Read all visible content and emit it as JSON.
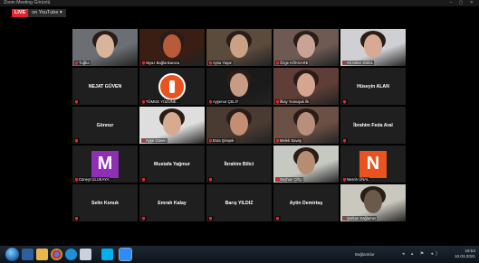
{
  "window": {
    "title": "Zoom Meeting Görüntü",
    "controls": "– ▢ ✕"
  },
  "live": {
    "badge": "LIVE",
    "destination": "on YouTube ▾"
  },
  "tiles": [
    {
      "kind": "video",
      "label": "Tuğba",
      "colors": [
        "#6b6f74",
        "#d8b49a"
      ]
    },
    {
      "kind": "video",
      "label": "Niyaz Bağlankaraca",
      "colors": [
        "#3a1e14",
        "#b85b3a"
      ]
    },
    {
      "kind": "video",
      "label": "Aysa Yaşar",
      "colors": [
        "#5a4b3d",
        "#caa184"
      ]
    },
    {
      "kind": "video",
      "label": "Özge KÖKSARE",
      "colors": [
        "#6e5a52",
        "#c9a394"
      ]
    },
    {
      "kind": "video",
      "label": "Ali Asker DİZEL",
      "colors": [
        "#cfcfd4",
        "#d8aa96"
      ]
    },
    {
      "kind": "name",
      "name": "NEJAT GÜVEN"
    },
    {
      "kind": "logo",
      "label": "TÜMGE YÜZÜNE..."
    },
    {
      "kind": "video",
      "label": "Ayşenur ÇELİT",
      "colors": [
        "#1a1a1a",
        "#c79b84"
      ]
    },
    {
      "kind": "video",
      "label": "İlkay Yumuşak İlk",
      "colors": [
        "#5e3e36",
        "#d5a590"
      ]
    },
    {
      "kind": "name",
      "name": "Hüseyin ALAN"
    },
    {
      "kind": "name",
      "name": "Gönnur"
    },
    {
      "kind": "video",
      "label": "Ayşe Güven",
      "colors": [
        "#dedede",
        "#d7ab8f"
      ]
    },
    {
      "kind": "video",
      "label": "Esra Şimşek",
      "colors": [
        "#4a3b32",
        "#c48e72"
      ],
      "active": true
    },
    {
      "kind": "video",
      "label": "Melek Savaş",
      "colors": [
        "#6b5045",
        "#b78f7a"
      ]
    },
    {
      "kind": "name",
      "name": "İbrahim Feda Aral"
    },
    {
      "kind": "avatar",
      "letter": "M",
      "bg": "#8e2fb5",
      "label": "Cüneyt ULUKAYA"
    },
    {
      "kind": "name",
      "name": "Mustafa Yağmur"
    },
    {
      "kind": "name",
      "name": "İbrahim Bilici"
    },
    {
      "kind": "video",
      "label": "Seyhan Çiftçi",
      "colors": [
        "#c6c8c2",
        "#b88c72"
      ]
    },
    {
      "kind": "avatar",
      "letter": "N",
      "bg": "#e8531f",
      "label": "Nesrin ÜNAL"
    },
    {
      "kind": "name",
      "name": "Selin Konuk"
    },
    {
      "kind": "name",
      "name": "Emrah Kalay"
    },
    {
      "kind": "name",
      "name": "Barış YILDIZ"
    },
    {
      "kind": "name",
      "name": "Aytin Demirtaş"
    },
    {
      "kind": "video",
      "label": "Şerkan Sağlamer",
      "colors": [
        "#c9c7be",
        "#6a5a4a"
      ]
    }
  ],
  "taskbar": {
    "network_text": "Bağlantılar",
    "tray_icons": "◂ ▴ ⚑ ◂)",
    "time": "19:54",
    "date": "10.03.2021"
  },
  "colors": {
    "live_red": "#e0262d",
    "active_outline": "#c8d84b",
    "tile_bg": "#1f1f1f"
  }
}
